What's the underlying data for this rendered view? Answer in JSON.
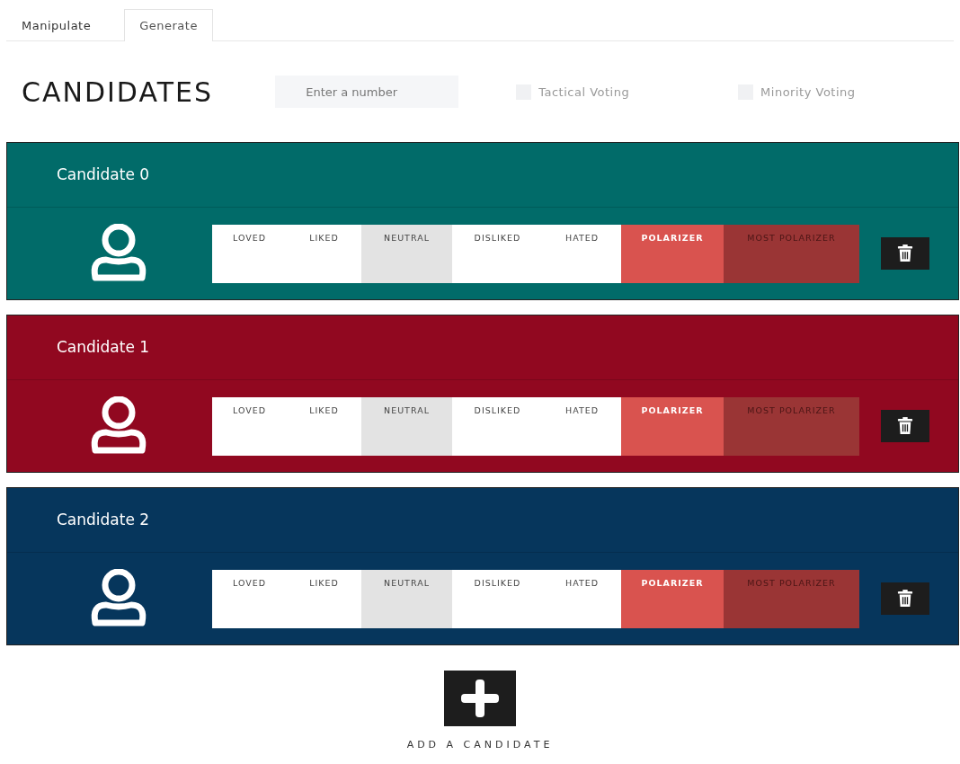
{
  "tabs": [
    {
      "label": "Manipulate",
      "selected": false
    },
    {
      "label": "Generate",
      "selected": true
    }
  ],
  "title": "CANDIDATES",
  "number_field": {
    "placeholder": "Enter a number"
  },
  "options": [
    {
      "label": "Tactical Voting",
      "checked": false
    },
    {
      "label": "Minority Voting",
      "checked": false
    }
  ],
  "candidates": [
    {
      "name": "Candidate 0",
      "color": "#016b69",
      "segments": [
        {
          "label": "LOVED",
          "kind": "plain"
        },
        {
          "label": "LIKED",
          "kind": "plain"
        },
        {
          "label": "NEUTRAL",
          "kind": "neutral"
        },
        {
          "label": "DISLIKED",
          "kind": "plain"
        },
        {
          "label": "HATED",
          "kind": "plain"
        },
        {
          "label": "POLARIZER",
          "kind": "polarizer"
        },
        {
          "label": "MOST POLARIZER",
          "kind": "most"
        }
      ]
    },
    {
      "name": "Candidate 1",
      "color": "#910820",
      "segments": [
        {
          "label": "LOVED",
          "kind": "plain"
        },
        {
          "label": "LIKED",
          "kind": "plain"
        },
        {
          "label": "NEUTRAL",
          "kind": "neutral"
        },
        {
          "label": "DISLIKED",
          "kind": "plain"
        },
        {
          "label": "HATED",
          "kind": "plain"
        },
        {
          "label": "POLARIZER",
          "kind": "polarizer"
        },
        {
          "label": "MOST POLARIZER",
          "kind": "most"
        }
      ]
    },
    {
      "name": "Candidate 2",
      "color": "#06365c",
      "segments": [
        {
          "label": "LOVED",
          "kind": "plain"
        },
        {
          "label": "LIKED",
          "kind": "plain"
        },
        {
          "label": "NEUTRAL",
          "kind": "neutral"
        },
        {
          "label": "DISLIKED",
          "kind": "plain"
        },
        {
          "label": "HATED",
          "kind": "plain"
        },
        {
          "label": "POLARIZER",
          "kind": "polarizer"
        },
        {
          "label": "MOST POLARIZER",
          "kind": "most"
        }
      ]
    }
  ],
  "add_label": "ADD A CANDIDATE"
}
